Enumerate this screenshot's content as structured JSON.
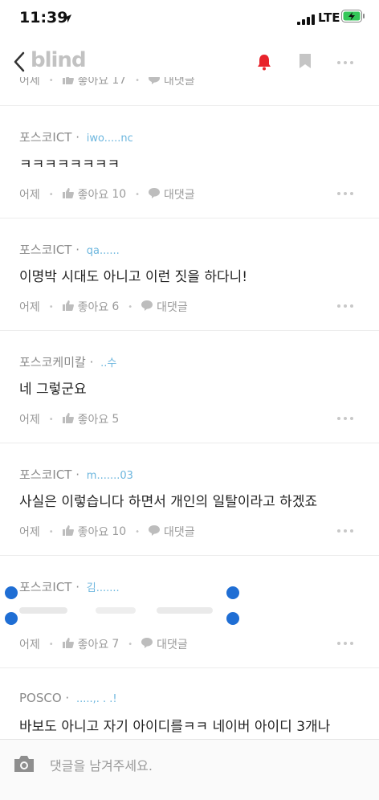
{
  "status_bar": {
    "time": "11:39",
    "network": "LTE"
  },
  "nav": {
    "logo": "blind"
  },
  "partial_top": {
    "time": "어제",
    "like_label": "좋아요",
    "like_count": "17",
    "reply_label": "대댓글"
  },
  "comments": [
    {
      "company": "포스코ICT",
      "handle": "iwo.....nc",
      "text": "ㅋㅋㅋㅋㅋㅋㅋㅋ",
      "time": "어제",
      "like_label": "좋아요",
      "like_count": "10",
      "reply_label": "대댓글"
    },
    {
      "company": "포스코ICT",
      "handle": "qa......",
      "text": "이명박 시대도 아니고 이런 짓을 하다니!",
      "time": "어제",
      "like_label": "좋아요",
      "like_count": "6",
      "reply_label": "대댓글"
    },
    {
      "company": "포스코케미칼",
      "handle": "..수",
      "text": "네 그렇군요",
      "time": "어제",
      "like_label": "좋아요",
      "like_count": "5",
      "reply_label": ""
    },
    {
      "company": "포스코ICT",
      "handle": "m.......03",
      "text": "사실은 이렇습니다 하면서 개인의 일탈이라고 하겠죠",
      "time": "어제",
      "like_label": "좋아요",
      "like_count": "10",
      "reply_label": "대댓글"
    },
    {
      "company": "포스코ICT",
      "handle": "김.......",
      "text": "",
      "time": "어제",
      "like_label": "좋아요",
      "like_count": "7",
      "reply_label": "대댓글"
    },
    {
      "company": "POSCO",
      "handle": ".....,. . .!",
      "text": "바보도 아니고 자기 아이디를ㅋㅋ 네이버 아이디 3개나",
      "time": "",
      "like_label": "",
      "like_count": "",
      "reply_label": ""
    }
  ],
  "composer": {
    "placeholder": "댓글을 남겨주세요."
  },
  "colors": {
    "bell": "#e8232b",
    "handle": "#6cb6de",
    "selection": "#1f6ed4"
  }
}
